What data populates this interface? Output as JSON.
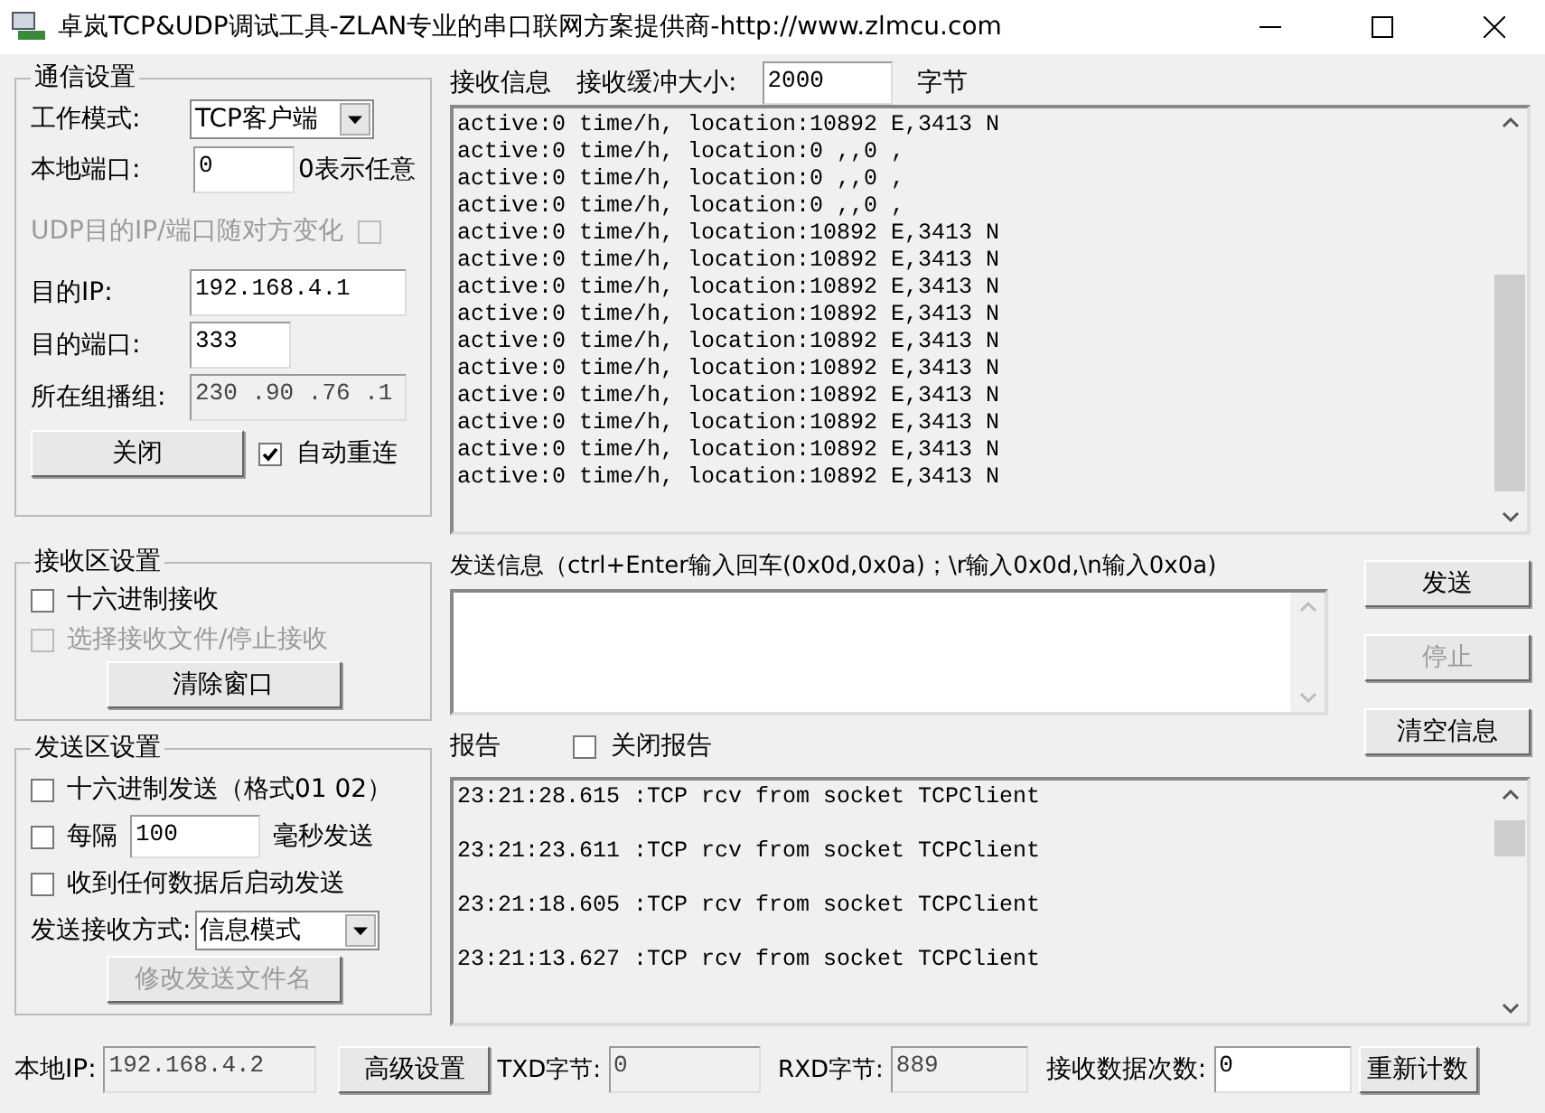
{
  "window": {
    "title": "卓岚TCP&UDP调试工具-ZLAN专业的串口联网方案提供商-http://www.zlmcu.com"
  },
  "comm_settings": {
    "title": "通信设置",
    "work_mode": {
      "label": "工作模式:",
      "value": "TCP客户端"
    },
    "local_port": {
      "label": "本地端口:",
      "value": "0",
      "note": "0表示任意"
    },
    "udp_follow": {
      "label": "UDP目的IP/端口随对方变化",
      "checked": false,
      "disabled": true
    },
    "dest_ip": {
      "label": "目的IP:",
      "value": "192.168.4.1"
    },
    "dest_port": {
      "label": "目的端口:",
      "value": "333"
    },
    "multicast": {
      "label": "所在组播组:",
      "value": "230 .90 .76 .1",
      "disabled": true
    },
    "close_button": "关闭",
    "auto_reconnect": {
      "label": "自动重连",
      "checked": true
    }
  },
  "receive_settings": {
    "title": "接收区设置",
    "options": [
      {
        "label": "十六进制接收",
        "checked": false,
        "disabled": false
      },
      {
        "label": "选择接收文件/停止接收",
        "checked": false,
        "disabled": true
      }
    ],
    "clear_button": "清除窗口"
  },
  "send_settings": {
    "title": "发送区设置",
    "hex_send": {
      "label": "十六进制发送（格式01 02）",
      "checked": false
    },
    "interval": {
      "label": "每隔",
      "value": "100",
      "unit": "毫秒发送",
      "checked": false
    },
    "send_after_receive": {
      "label": "收到任何数据后启动发送",
      "checked": false
    },
    "mode": {
      "label": "发送接收方式:",
      "value": "信息模式"
    },
    "file_button": {
      "label": "修改发送文件名",
      "disabled": true
    }
  },
  "receive": {
    "title": "接收信息",
    "buffer_label": "接收缓冲大小:",
    "buffer_value": "2000",
    "buffer_unit": "字节",
    "lines": [
      "active:0 time/h, location:10892 E,3413 N",
      "active:0 time/h, location:0 ,,0 ,",
      "active:0 time/h, location:0 ,,0 ,",
      "active:0 time/h, location:0 ,,0 ,",
      "active:0 time/h, location:10892 E,3413 N",
      "active:0 time/h, location:10892 E,3413 N",
      "active:0 time/h, location:10892 E,3413 N",
      "active:0 time/h, location:10892 E,3413 N",
      "active:0 time/h, location:10892 E,3413 N",
      "active:0 time/h, location:10892 E,3413 N",
      "active:0 time/h, location:10892 E,3413 N",
      "active:0 time/h, location:10892 E,3413 N",
      "active:0 time/h, location:10892 E,3413 N",
      "active:0 time/h, location:10892 E,3413 N"
    ]
  },
  "send": {
    "title": "发送信息（ctrl+Enter输入回车(0x0d,0x0a)；\\r输入0x0d,\\n输入0x0a)"
  },
  "side_buttons": [
    {
      "label": "发送",
      "disabled": false
    },
    {
      "label": "停止",
      "disabled": true
    },
    {
      "label": "清空信息",
      "disabled": false
    }
  ],
  "report": {
    "title": "报告",
    "close_report": {
      "label": "关闭报告",
      "checked": false
    },
    "lines": [
      "23:21:28.615 :TCP rcv from socket TCPClient",
      "23:21:23.611 :TCP rcv from socket TCPClient",
      "23:21:18.605 :TCP rcv from socket TCPClient",
      "23:21:13.627 :TCP rcv from socket TCPClient"
    ]
  },
  "status_bar": {
    "local_ip": {
      "label": "本地IP:",
      "value": "192.168.4.2"
    },
    "advanced_button": "高级设置",
    "txd": {
      "label": "TXD字节:",
      "value": "0"
    },
    "rxd": {
      "label": "RXD字节:",
      "value": "889"
    },
    "count": {
      "label": "接收数据次数:",
      "value": "0"
    },
    "reset_button": "重新计数"
  }
}
